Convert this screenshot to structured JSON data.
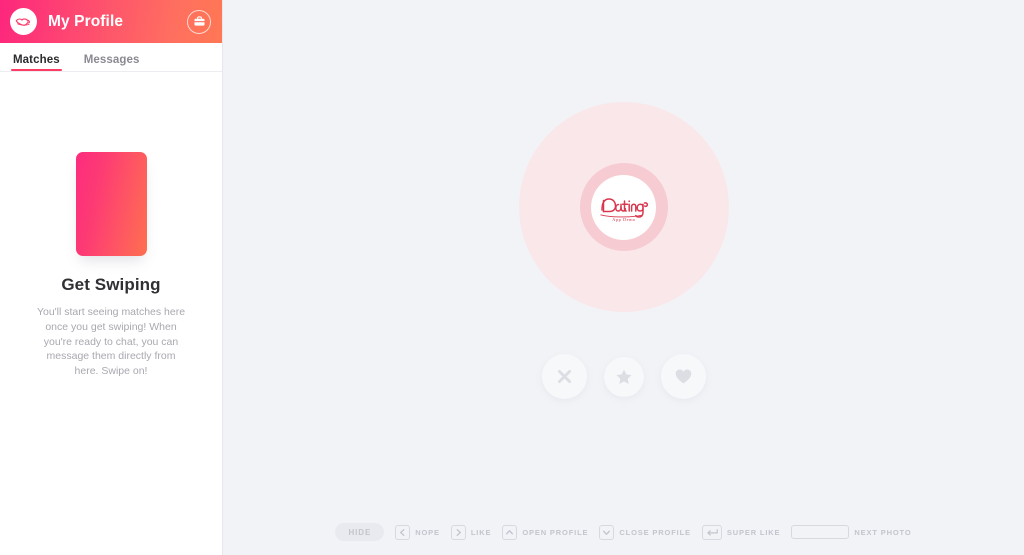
{
  "app": {
    "brand_icon": "dating-logo-icon",
    "bg_color": "#f2f3f7",
    "accent_gradient_from": "#fd267d",
    "accent_gradient_to": "#ff7854"
  },
  "sidebar": {
    "header": {
      "avatar_icon": "brand-avatar-icon",
      "title": "My Profile",
      "action_icon": "briefcase-icon"
    },
    "tabs": [
      {
        "label": "Matches",
        "active": true
      },
      {
        "label": "Messages",
        "active": false
      }
    ],
    "empty_state": {
      "card_icon": "gradient-card-placeholder",
      "title": "Get Swiping",
      "description": "You'll start seeing matches here once you get swiping! When you're ready to chat, you can message them directly from here. Swipe on!"
    }
  },
  "main": {
    "logo": {
      "icon": "dating-script-logo-icon",
      "wordmark": "Dating",
      "tagline": "App Demo",
      "outer_ring_color": "#fae7ea",
      "inner_ring_color": "#f6cbd1"
    },
    "actions": [
      {
        "name": "nope-button",
        "icon": "x-icon",
        "label": "Nope"
      },
      {
        "name": "super-like-button",
        "icon": "star-icon",
        "label": "Super Like"
      },
      {
        "name": "like-button",
        "icon": "heart-icon",
        "label": "Like"
      }
    ],
    "shortcuts": {
      "hide_label": "HIDE",
      "items": [
        {
          "key_icon": "arrow-left-icon",
          "key_type": "key",
          "label": "NOPE"
        },
        {
          "key_icon": "arrow-right-icon",
          "key_type": "key",
          "label": "LIKE"
        },
        {
          "key_icon": "arrow-up-icon",
          "key_type": "key",
          "label": "OPEN PROFILE"
        },
        {
          "key_icon": "arrow-down-icon",
          "key_type": "key",
          "label": "CLOSE PROFILE"
        },
        {
          "key_icon": "enter-key-icon",
          "key_type": "enter",
          "label": "SUPER LIKE"
        },
        {
          "key_icon": "spacebar-icon",
          "key_type": "space",
          "label": "NEXT PHOTO"
        }
      ]
    }
  }
}
